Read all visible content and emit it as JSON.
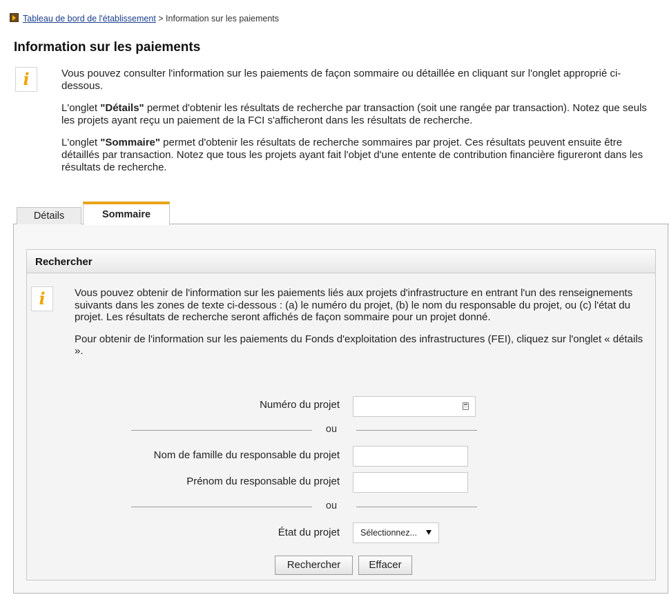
{
  "breadcrumb": {
    "link": "Tableau de bord de l'établissement",
    "separator": " > ",
    "current": "Information sur les paiements"
  },
  "page_title": "Information sur les paiements",
  "intro": {
    "p1": "Vous pouvez consulter l'information sur les paiements de façon sommaire ou détaillée en cliquant sur l'onglet approprié ci-dessous.",
    "p2_prefix": "L'onglet ",
    "p2_bold": "\"Détails\"",
    "p2_suffix": " permet d'obtenir les résultats de recherche par transaction (soit une rangée par transaction). Notez que seuls les projets ayant reçu un paiement de la FCI s'afficheront dans les résultats de recherche.",
    "p3_prefix": "L'onglet ",
    "p3_bold": "\"Sommaire\"",
    "p3_suffix": " permet d'obtenir les résultats de recherche sommaires par projet. Ces résultats peuvent ensuite être détaillés par transaction. Notez que tous les projets ayant fait l'objet d'une entente de contribution financière figureront dans les résultats de recherche."
  },
  "tabs": {
    "details": "Détails",
    "summary": "Sommaire"
  },
  "search": {
    "header": "Rechercher",
    "p1": "Vous pouvez obtenir de l'information sur les paiements liés aux projets d'infrastructure en entrant l'un des renseignements suivants dans les zones de texte ci-dessous : (a) le numéro du projet, (b) le nom du responsable du projet, ou (c) l'état du projet. Les résultats de recherche seront affichés de façon sommaire pour un projet donné.",
    "p2": "Pour obtenir de l'information sur les paiements du Fonds d'exploitation des infrastructures (FEI), cliquez sur l'onglet « détails ».",
    "project_number_label": "Numéro du projet",
    "project_number_value": "",
    "or_1": "ou",
    "last_name_label": "Nom de famille du responsable du projet",
    "last_name_value": "",
    "first_name_label": "Prénom du responsable du projet",
    "first_name_value": "",
    "or_2": "ou",
    "status_label": "État du projet",
    "status_selected": "Sélectionnez...",
    "search_button": "Rechercher",
    "clear_button": "Effacer"
  },
  "colors": {
    "link": "#1a3e8c",
    "tab_accent": "#e9a418",
    "info_icon": "#f0a500"
  },
  "icons": {
    "breadcrumb": "arrow-right-icon",
    "info": "info-icon",
    "calculator": "calculator-icon",
    "dropdown": "dropdown-arrow-icon"
  }
}
